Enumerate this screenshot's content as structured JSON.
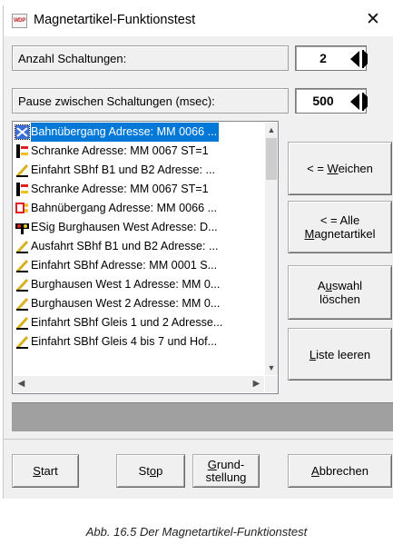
{
  "window": {
    "title": "Magnetartikel-Funktionstest",
    "close_icon": "close-icon",
    "app_icon_text": "WDP"
  },
  "switch_count": {
    "label": "Anzahl Schaltungen:",
    "value": "2"
  },
  "pause": {
    "label": "Pause zwischen Schaltungen (msec):",
    "value": "500"
  },
  "list": {
    "items": [
      {
        "text": "Bahnübergang Adresse: MM 0066 ...",
        "icon": "level-crossing-icon",
        "selected": true
      },
      {
        "text": "Schranke Adresse: MM 0067 ST=1",
        "icon": "barrier-icon"
      },
      {
        "text": "Einfahrt SBhf B1 und B2 Adresse: ...",
        "icon": "turnout-icon"
      },
      {
        "text": "Schranke Adresse: MM 0067 ST=1",
        "icon": "barrier-icon"
      },
      {
        "text": "Bahnübergang Adresse: MM 0066 ...",
        "icon": "signal-lights-icon"
      },
      {
        "text": "ESig Burghausen West Adresse: D...",
        "icon": "entry-signal-icon"
      },
      {
        "text": "Ausfahrt SBhf B1 und B2 Adresse: ...",
        "icon": "turnout-icon"
      },
      {
        "text": "Einfahrt SBhf Adresse: MM 0001 S...",
        "icon": "turnout-icon"
      },
      {
        "text": "Burghausen West 1 Adresse: MM 0...",
        "icon": "turnout-icon"
      },
      {
        "text": "Burghausen West 2 Adresse: MM 0...",
        "icon": "turnout-icon"
      },
      {
        "text": "Einfahrt SBhf Gleis 1 und 2 Adresse...",
        "icon": "turnout-icon"
      },
      {
        "text": "Einfahrt SBhf Gleis 4 bis 7 und Hof...",
        "icon": "turnout-icon"
      }
    ]
  },
  "buttons": {
    "weichen": {
      "prefix": "< = ",
      "mnemonic": "W",
      "rest": "eichen"
    },
    "alle": {
      "line1": "< = Alle",
      "mnemonic": "M",
      "rest": "agnetartikel"
    },
    "auswahl": {
      "pre": "A",
      "mnemonic": "u",
      "rest": "swahl",
      "line2": "löschen"
    },
    "liste": {
      "mnemonic": "L",
      "rest": "iste leeren"
    },
    "start": {
      "mnemonic": "S",
      "rest": "tart"
    },
    "stop": {
      "pre": "St",
      "mnemonic": "o",
      "rest": "p"
    },
    "grund": {
      "mnemonic": "G",
      "rest": "rund-",
      "line2": "stellung"
    },
    "abbrechen": {
      "mnemonic": "A",
      "rest": "bbrechen"
    }
  },
  "caption": "Abb. 16.5    Der Magnetartikel-Funktionstest",
  "colors": {
    "selection": "#0078d7",
    "dialog_bg": "#f0f0f0",
    "status_bar": "#a0a0a0"
  }
}
